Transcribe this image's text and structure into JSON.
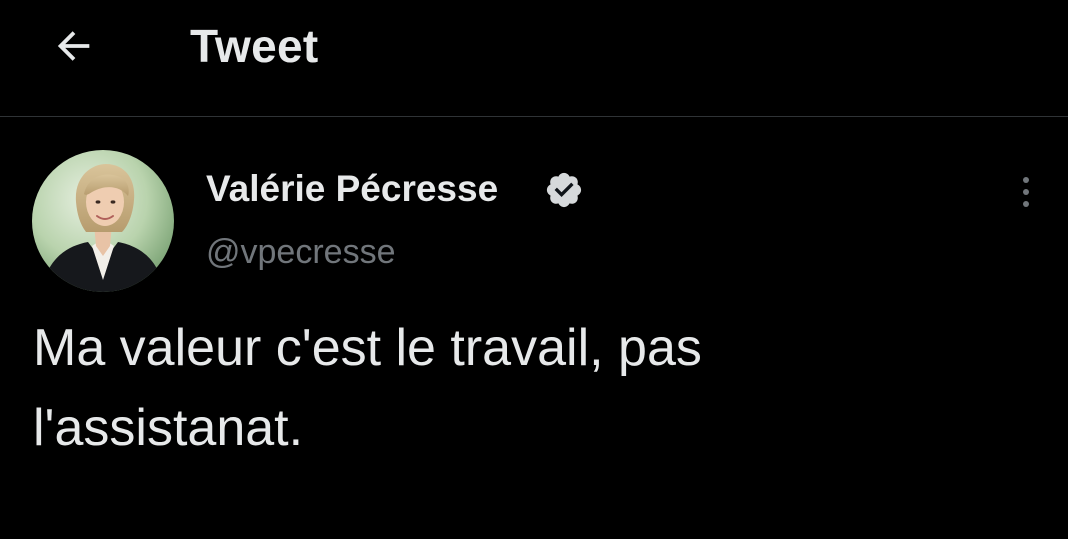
{
  "header": {
    "back_icon": "arrow-left-icon",
    "title": "Tweet"
  },
  "tweet": {
    "author": {
      "name": "Valérie Pécresse",
      "handle": "@vpecresse",
      "verified": true,
      "verified_icon": "verified-badge-icon",
      "avatar_icon": "profile-photo"
    },
    "text": "Ma valeur c'est le travail, pas\nl'assistanat.",
    "more_icon": "more-vertical-icon"
  },
  "colors": {
    "background": "#000000",
    "primary_text": "#e7e9ea",
    "secondary_text": "#71767b",
    "divider": "#2f3336"
  }
}
